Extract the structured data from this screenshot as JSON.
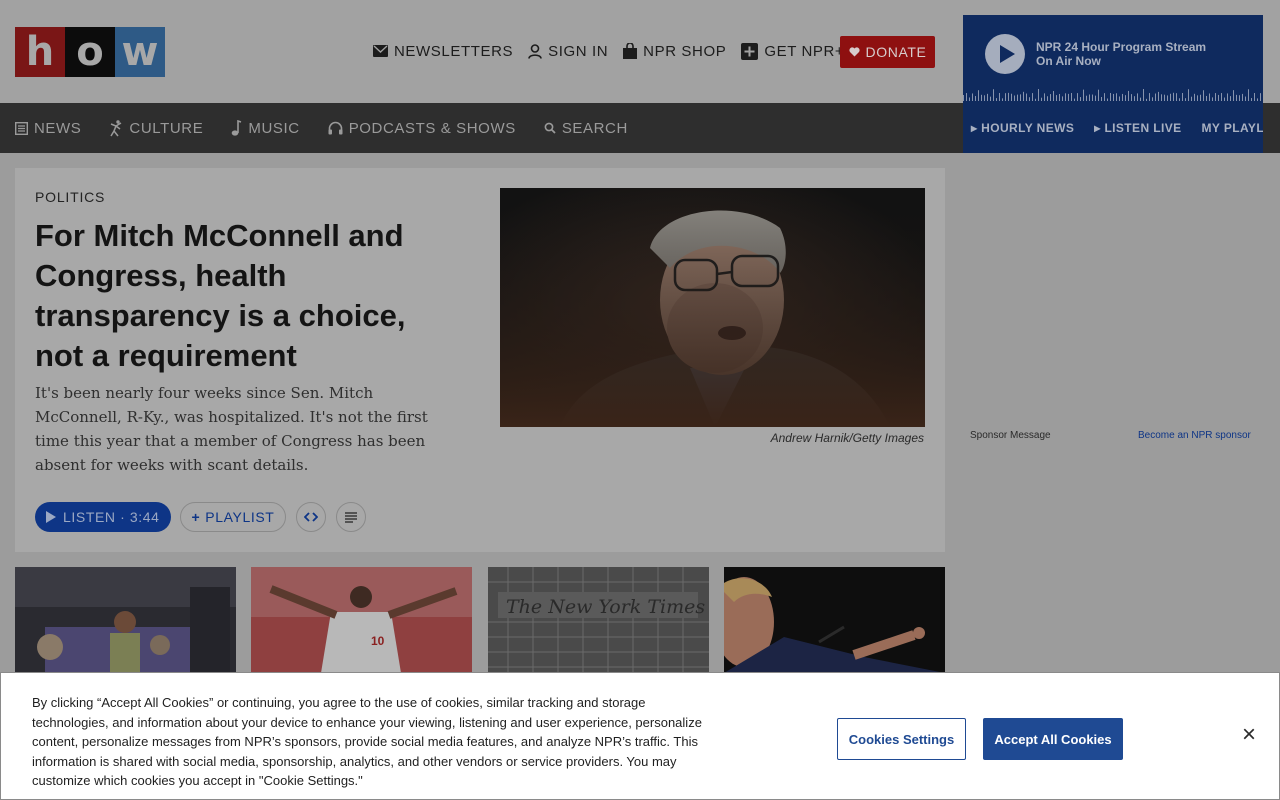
{
  "header": {
    "logo": {
      "letters": [
        "h",
        "o",
        "w"
      ]
    },
    "nav": [
      {
        "label": "NEWSLETTERS",
        "icon": "envelope-icon"
      },
      {
        "label": "SIGN IN",
        "icon": "user-icon"
      },
      {
        "label": "NPR SHOP",
        "icon": "shopping-bag-icon"
      },
      {
        "label": "GET NPR+",
        "icon": "plus-square-icon"
      }
    ],
    "donate_label": "DONATE"
  },
  "player": {
    "title": "NPR 24 Hour Program Stream",
    "subtitle": "On Air Now",
    "links": [
      "HOURLY NEWS",
      "LISTEN LIVE",
      "MY PLAYLIST"
    ]
  },
  "section_nav": [
    {
      "label": "NEWS",
      "icon": "newspaper-icon"
    },
    {
      "label": "CULTURE",
      "icon": "dancer-icon"
    },
    {
      "label": "MUSIC",
      "icon": "music-note-icon"
    },
    {
      "label": "PODCASTS & SHOWS",
      "icon": "headphones-icon"
    },
    {
      "label": "SEARCH",
      "icon": "search-icon"
    }
  ],
  "story": {
    "kicker": "POLITICS",
    "headline": "For Mitch McConnell and Congress, health transparency is a choice, not a requirement",
    "teaser": "It's been nearly four weeks since Sen. Mitch McConnell, R-Ky., was hospitalized. It's not the first time this year that a member of Congress has been absent for weeks with scant details.",
    "photo_credit": "Andrew Harnik/Getty Images",
    "listen_label": "LISTEN · 3:44",
    "playlist_label": "PLAYLIST"
  },
  "sponsor": {
    "label": "Sponsor Message",
    "link": "Become an NPR sponsor"
  },
  "cookie_banner": {
    "text": "By clicking “Accept All Cookies” or continuing, you agree to the use of cookies, similar tracking and storage technologies, and information about your device to enhance your viewing, listening and user experience, personalize content, personalize messages from NPR’s sponsors, provide social media features, and analyze NPR’s traffic. This information is shared with social media, sponsorship, analytics, and other vendors or service providers. You may customize which cookies you accept in \"Cookie Settings.\"",
    "settings_label": "Cookies Settings",
    "accept_label": "Accept All Cookies",
    "close_label": "×"
  },
  "colors": {
    "brand_red": "#8e1010",
    "brand_blue": "#0e3586",
    "cookie_button": "#1f4a93"
  }
}
